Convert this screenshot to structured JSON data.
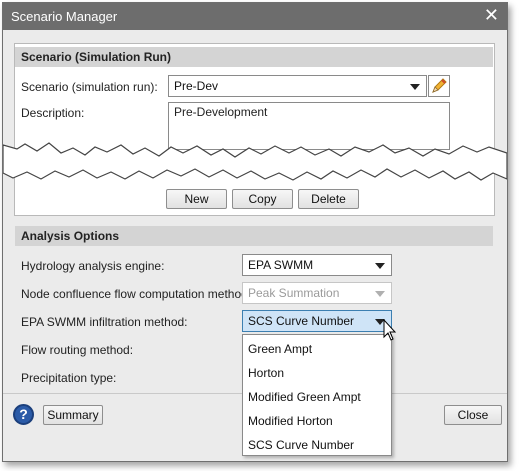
{
  "window": {
    "title": "Scenario Manager",
    "close_glyph": "✕"
  },
  "scenario": {
    "header": "Scenario (Simulation Run)",
    "run_label": "Scenario (simulation run):",
    "run_value": "Pre-Dev",
    "description_label": "Description:",
    "description_value": "Pre-Development",
    "edit_icon": "pencil-icon",
    "new_button": "New",
    "copy_button": "Copy",
    "delete_button": "Delete"
  },
  "analysis": {
    "header": "Analysis Options",
    "hydrology_label": "Hydrology analysis engine:",
    "hydrology_value": "EPA SWMM",
    "node_label": "Node confluence flow computation method:",
    "node_value": "Peak Summation",
    "infiltration_label": "EPA SWMM infiltration method:",
    "infiltration_value": "SCS Curve Number",
    "routing_label": "Flow routing method:",
    "precip_label": "Precipitation type:",
    "dropdown_options": [
      "Green Ampt",
      "Horton",
      "Modified Green Ampt",
      "Modified Horton",
      "SCS Curve Number"
    ]
  },
  "footer": {
    "help_glyph": "?",
    "summary_button": "Summary",
    "close_button": "Close"
  },
  "colors": {
    "title_bar": "#6d6d6d",
    "section_header": "#d4d4d4",
    "selected_field": "#cfe4f7"
  }
}
